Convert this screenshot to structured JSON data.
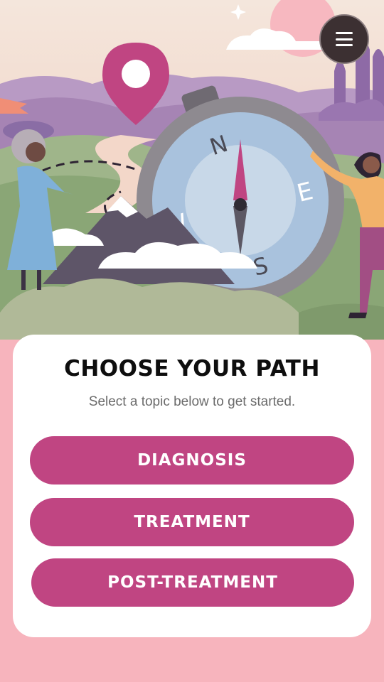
{
  "header": {
    "menu_icon": "hamburger-menu-icon"
  },
  "hero": {
    "compass_letters": {
      "north": "N",
      "east": "E",
      "south": "S",
      "west": "W"
    }
  },
  "card": {
    "title": "CHOOSE YOUR PATH",
    "subtitle": "Select a topic below to get started.",
    "buttons": [
      {
        "label": "DIAGNOSIS"
      },
      {
        "label": "TREATMENT"
      },
      {
        "label": "POST-TREATMENT"
      }
    ]
  },
  "colors": {
    "page_background": "#f7b4bd",
    "button": "#c04582",
    "card": "#ffffff",
    "title": "#0e0e0e",
    "subtitle": "#6b6b6b"
  }
}
